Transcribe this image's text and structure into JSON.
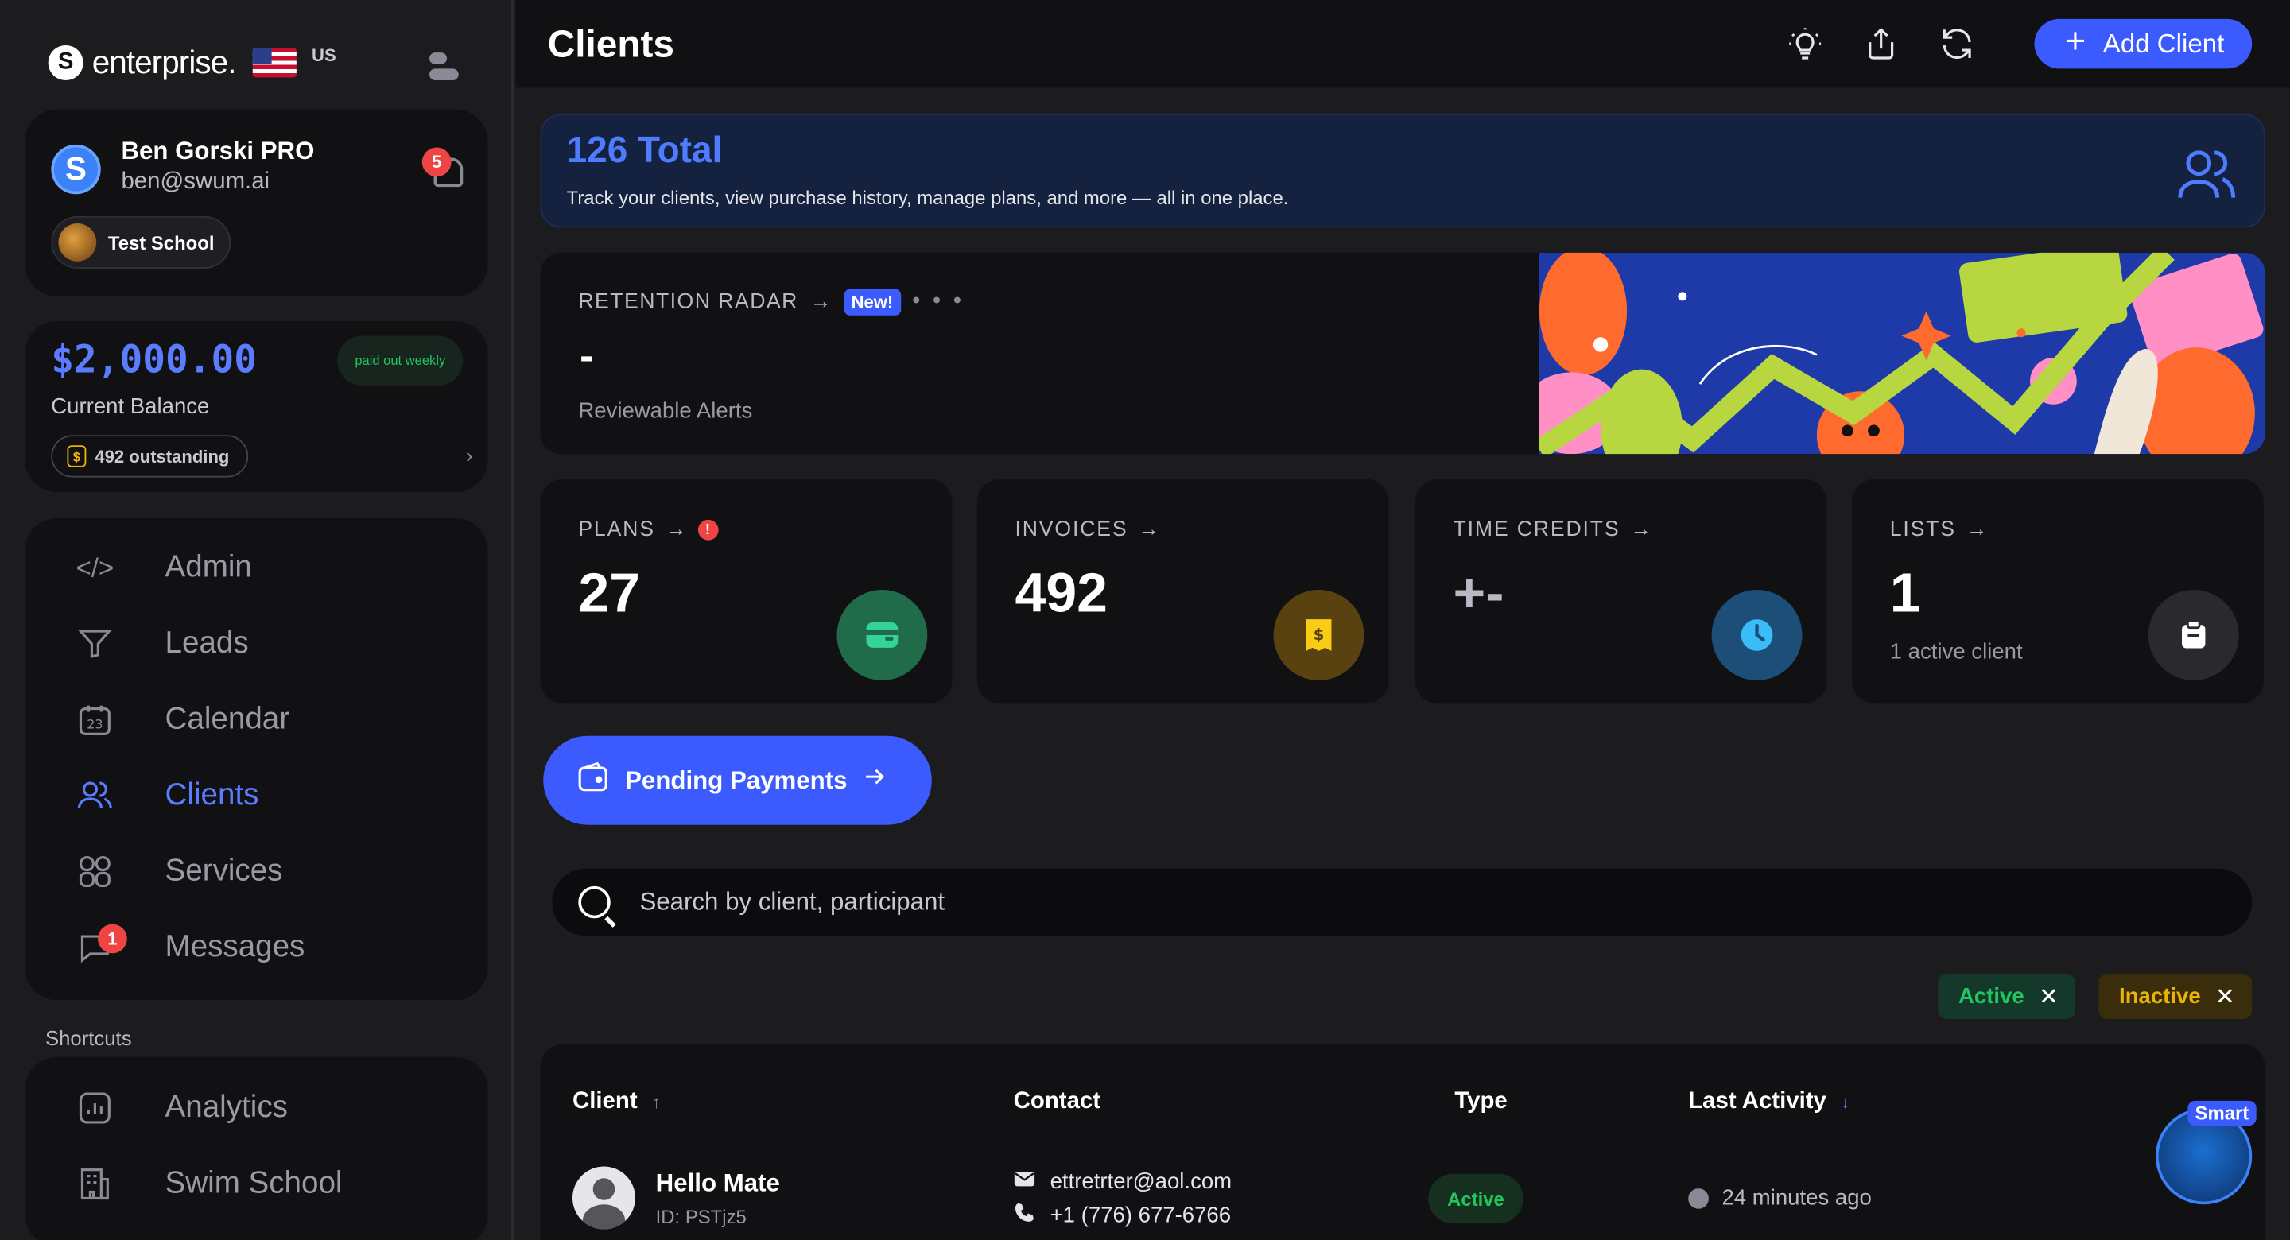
{
  "brand": {
    "logo_letter": "S",
    "name": "enterprise.",
    "region": "US"
  },
  "profile": {
    "avatar_letter": "S",
    "name": "Ben Gorski PRO",
    "email": "ben@swum.ai",
    "notifications": "5",
    "school": "Test School"
  },
  "balance": {
    "amount": "$2,000.00",
    "label": "Current Balance",
    "payout": "paid out weekly",
    "outstanding": "492 outstanding",
    "dollar_glyph": "$"
  },
  "nav": [
    {
      "label": "Admin",
      "icon": "code-icon"
    },
    {
      "label": "Leads",
      "icon": "funnel-icon"
    },
    {
      "label": "Calendar",
      "icon": "calendar-icon",
      "icon_text": "23"
    },
    {
      "label": "Clients",
      "icon": "users-icon",
      "active": true
    },
    {
      "label": "Services",
      "icon": "services-icon"
    },
    {
      "label": "Messages",
      "icon": "chat-icon",
      "badge": "1"
    }
  ],
  "shortcuts": {
    "label": "Shortcuts",
    "items": [
      {
        "label": "Analytics",
        "icon": "analytics-icon"
      },
      {
        "label": "Swim School",
        "icon": "building-icon"
      }
    ]
  },
  "header": {
    "title": "Clients",
    "add_label": "Add Client"
  },
  "summary": {
    "total": "126 Total",
    "description": "Track your clients, view purchase history, manage plans, and more — all in one place."
  },
  "radar": {
    "title": "RETENTION RADAR",
    "new_tag": "New!",
    "value": "-",
    "subtitle": "Reviewable Alerts",
    "menu": "• • •"
  },
  "stats": [
    {
      "label": "PLANS",
      "value": "27",
      "sub": "",
      "warn": "!",
      "icon_bg": "#1f6b4a",
      "icon_fg": "#34d399"
    },
    {
      "label": "INVOICES",
      "value": "492",
      "sub": "",
      "icon_bg": "#5a4210",
      "icon_fg": "#facc15"
    },
    {
      "label": "TIME CREDITS",
      "value": "+-",
      "sub": "",
      "icon_bg": "#1d4e78",
      "icon_fg": "#38bdf8"
    },
    {
      "label": "LISTS",
      "value": "1",
      "sub": "1 active client",
      "icon_bg": "#2a2a2e",
      "icon_fg": "#ffffff"
    }
  ],
  "pending": {
    "label": "Pending Payments"
  },
  "search": {
    "placeholder": "Search by client, participant"
  },
  "filters": [
    {
      "label": "Active",
      "bg": "#14392a",
      "fg": "#22c55e"
    },
    {
      "label": "Inactive",
      "bg": "#3a2d0c",
      "fg": "#eab308"
    }
  ],
  "table": {
    "columns": [
      "Client",
      "Contact",
      "Type",
      "Last Activity"
    ],
    "sort_up": "↑",
    "sort_down": "↓",
    "rows": [
      {
        "name": "Hello Mate",
        "id": "ID: PSTjz5",
        "email": "ettretrter@aol.com",
        "phone": "+1 (776) 677-6766",
        "type": "Active",
        "activity": "24 minutes ago"
      }
    ]
  },
  "assistant": {
    "tag": "Smart"
  }
}
